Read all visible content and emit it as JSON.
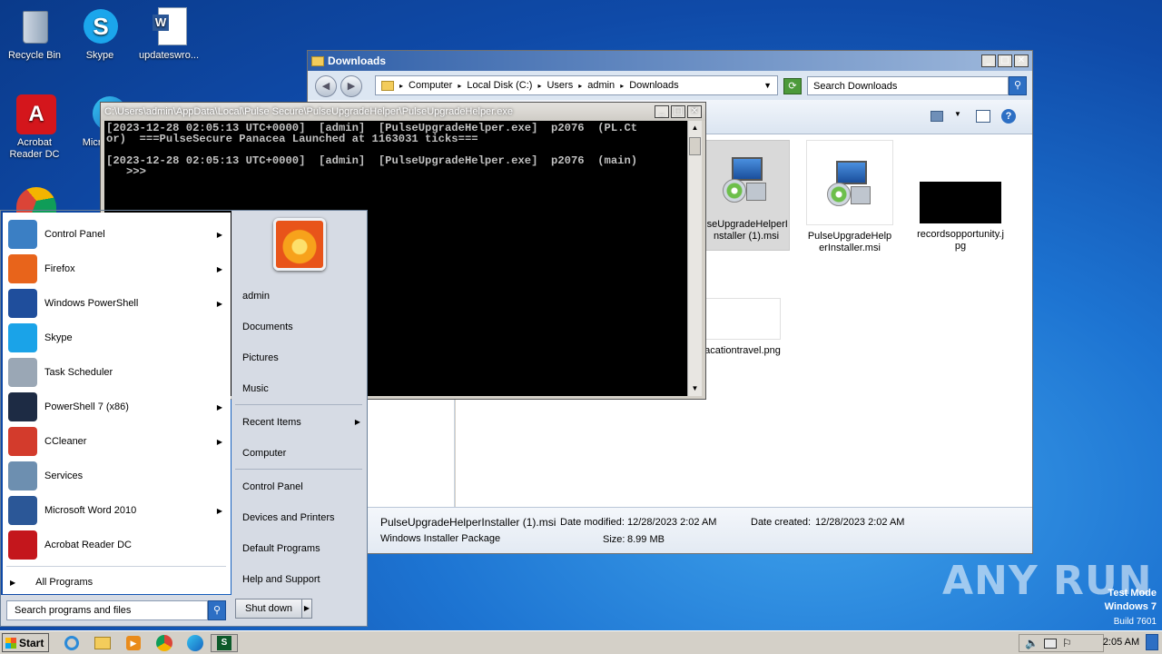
{
  "desktop": {
    "icons": [
      {
        "label": "Recycle Bin"
      },
      {
        "label": "Skype"
      },
      {
        "label": "updateswro..."
      },
      {
        "label": "Acrobat Reader DC"
      },
      {
        "label": "Microso"
      }
    ]
  },
  "explorer": {
    "title": "Downloads",
    "breadcrumb": [
      "Computer",
      "Local Disk (C:)",
      "Users",
      "admin",
      "Downloads"
    ],
    "search_placeholder": "Search Downloads",
    "files": [
      {
        "name": "lseUpgradeHelperInstaller (1).msi"
      },
      {
        "name": "PulseUpgradeHelperInstaller.msi"
      },
      {
        "name": "recordsopportunity.jpg"
      },
      {
        "name": "acationtravel.png"
      }
    ],
    "details": {
      "filename": "PulseUpgradeHelperInstaller (1).msi",
      "type": "Windows Installer Package",
      "modified_label": "Date modified:",
      "modified_value": "12/28/2023 2:02 AM",
      "created_label": "Date created:",
      "created_value": "12/28/2023 2:02 AM",
      "size_label": "Size:",
      "size_value": "8.99 MB"
    }
  },
  "console": {
    "title": "C:\\Users\\admin\\AppData\\Local\\Pulse Secure\\PulseUpgradeHelper\\PulseUpgradeHelper.exe",
    "text": "[2023-12-28 02:05:13 UTC+0000]  [admin]  [PulseUpgradeHelper.exe]  p2076  (PL.Ct\nor)  ===PulseSecure Panacea Launched at 1163031 ticks===\n\n[2023-12-28 02:05:13 UTC+0000]  [admin]  [PulseUpgradeHelper.exe]  p2076  (main)\n   >>>"
  },
  "startmenu": {
    "programs": [
      {
        "label": "Control Panel",
        "arrow": true,
        "icon": "control-panel-icon",
        "color": "#3b7fc4"
      },
      {
        "label": "Firefox",
        "arrow": true,
        "icon": "firefox-icon",
        "color": "#e8641b"
      },
      {
        "label": "Windows PowerShell",
        "arrow": true,
        "icon": "powershell-icon",
        "color": "#1f4e9c"
      },
      {
        "label": "Skype",
        "arrow": false,
        "icon": "skype-icon",
        "color": "#1aa3e8"
      },
      {
        "label": "Task Scheduler",
        "arrow": false,
        "icon": "clock-icon",
        "color": "#9aa7b5"
      },
      {
        "label": "PowerShell 7 (x86)",
        "arrow": true,
        "icon": "powershell7-icon",
        "color": "#1d2b44"
      },
      {
        "label": "CCleaner",
        "arrow": true,
        "icon": "ccleaner-icon",
        "color": "#d33b2c"
      },
      {
        "label": "Services",
        "arrow": false,
        "icon": "services-gear-icon",
        "color": "#6d8fb0"
      },
      {
        "label": "Microsoft Word 2010",
        "arrow": true,
        "icon": "word-icon",
        "color": "#2b5797"
      },
      {
        "label": "Acrobat Reader DC",
        "arrow": false,
        "icon": "acrobat-icon",
        "color": "#c4161c"
      }
    ],
    "all_programs": "All Programs",
    "search_placeholder": "Search programs and files",
    "right": {
      "user": "admin",
      "documents": "Documents",
      "pictures": "Pictures",
      "music": "Music",
      "recent": "Recent Items",
      "computer": "Computer",
      "control_panel": "Control Panel",
      "devices": "Devices and Printers",
      "default_programs": "Default Programs",
      "help": "Help and Support"
    },
    "shutdown": "Shut down"
  },
  "taskbar": {
    "start": "Start",
    "clock": "2:05 AM"
  },
  "watermark": {
    "brand": "ANY RUN",
    "line1": "Test Mode",
    "line2": "Windows 7",
    "line3": "Build 7601"
  }
}
